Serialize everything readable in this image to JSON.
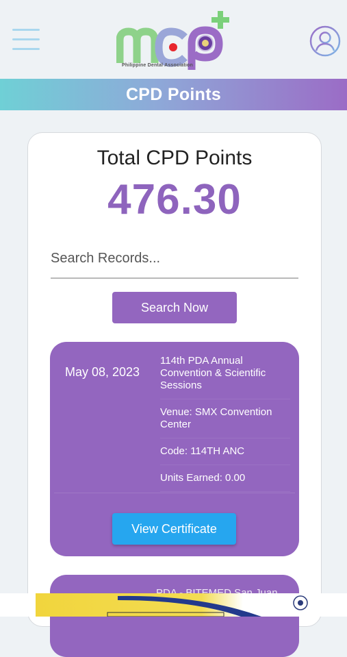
{
  "header": {
    "menu_icon": "hamburger-menu-icon",
    "logo_text": "mcp",
    "logo_tagline": "Philippine Dental Association",
    "profile_icon": "user-profile-icon"
  },
  "page_title": "CPD Points",
  "summary": {
    "label": "Total CPD Points",
    "value": "476.30"
  },
  "search": {
    "placeholder": "Search Records...",
    "value": "",
    "button_label": "Search Now"
  },
  "records": [
    {
      "date": "May 08, 2023",
      "title": "114th PDA  Annual Convention & Scientific Sessions",
      "venue": "Venue: SMX Convention Center",
      "code": "Code: 114TH ANC",
      "units": "Units Earned: 0.00",
      "button_label": "View Certificate"
    },
    {
      "partial_text": "PDA - BITEMED San Juan"
    }
  ],
  "colors": {
    "accent_purple": "#9366bf",
    "total_value": "#8e64bd",
    "button_blue": "#26a6ef",
    "title_gradient_start": "#6fd0d6",
    "title_gradient_end": "#9b6cc6"
  }
}
